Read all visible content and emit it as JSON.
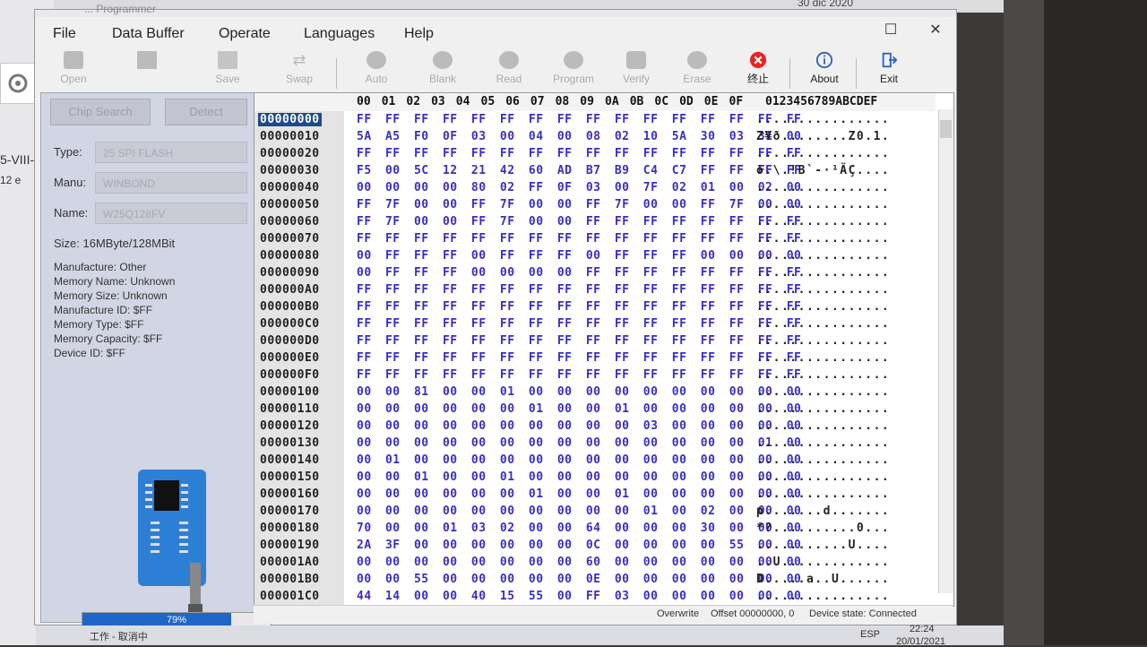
{
  "window": {
    "title": "... Programmer",
    "date_top": "30 dic 2020"
  },
  "background": {
    "side_text_1": "5-VIII-",
    "side_text_2": "12 e"
  },
  "menu": [
    "File",
    "Data Buffer",
    "Operate",
    "Languages",
    "Help"
  ],
  "toolbar": [
    {
      "label": "Open",
      "active": false
    },
    {
      "label": "",
      "active": false
    },
    {
      "label": "Save",
      "active": false
    },
    {
      "label": "Swap",
      "active": false
    },
    {
      "label": "Auto",
      "active": false
    },
    {
      "label": "Blank",
      "active": false
    },
    {
      "label": "Read",
      "active": false
    },
    {
      "label": "Program",
      "active": false
    },
    {
      "label": "Verify",
      "active": false
    },
    {
      "label": "Erase",
      "active": false
    },
    {
      "label": "终止",
      "active": true
    },
    {
      "label": "About",
      "active": true
    },
    {
      "label": "Exit",
      "active": true
    }
  ],
  "left": {
    "chip_search": "Chip Search",
    "detect": "Detect",
    "type_label": "Type:",
    "type_value": "25 SPI FLASH",
    "manu_label": "Manu:",
    "manu_value": "WINBOND",
    "name_label": "Name:",
    "name_value": "W25Q128FV",
    "size": "Size:  16MByte/128MBit",
    "info": [
      "Manufacture: Other",
      "Memory Name: Unknown",
      "Memory Size: Unknown",
      "Manufacture ID: $FF",
      "Memory Type: $FF",
      "Memory Capacity: $FF",
      "Device ID: $FF"
    ],
    "progress_value": 0.79,
    "progress_text": "79%"
  },
  "hex": {
    "header_cols": [
      "00",
      "01",
      "02",
      "03",
      "04",
      "05",
      "06",
      "07",
      "08",
      "09",
      "0A",
      "0B",
      "0C",
      "0D",
      "0E",
      "0F"
    ],
    "ascii_header": "0123456789ABCDEF",
    "rows": [
      {
        "addr": "00000000",
        "bytes": "FF FF FF FF FF FF FF FF FF FF FF FF FF FF FF FF",
        "ascii": "................"
      },
      {
        "addr": "00000010",
        "bytes": "5A A5 F0 0F 03 00 04 00 08 02 10 5A 30 03 31 00",
        "ascii": "Z¥ð........Z0.1."
      },
      {
        "addr": "00000020",
        "bytes": "FF FF FF FF FF FF FF FF FF FF FF FF FF FF FF FF",
        "ascii": "................"
      },
      {
        "addr": "00000030",
        "bytes": "F5 00 5C 12 21 42 60 AD B7 B9 C4 C7 FF FF FF FF",
        "ascii": "õ.\\.!B`-·¹ÄÇ...."
      },
      {
        "addr": "00000040",
        "bytes": "00 00 00 00 80 02 FF 0F 03 00 7F 02 01 00 02 00",
        "ascii": "................"
      },
      {
        "addr": "00000050",
        "bytes": "FF 7F 00 00 FF 7F 00 00 FF 7F 00 00 FF 7F 00 00",
        "ascii": "................"
      },
      {
        "addr": "00000060",
        "bytes": "FF 7F 00 00 FF 7F 00 00 FF FF FF FF FF FF FF FF",
        "ascii": "................"
      },
      {
        "addr": "00000070",
        "bytes": "FF FF FF FF FF FF FF FF FF FF FF FF FF FF FF FF",
        "ascii": "................"
      },
      {
        "addr": "00000080",
        "bytes": "00 FF FF FF 00 FF FF FF 00 FF FF FF 00 00 00 00",
        "ascii": "................"
      },
      {
        "addr": "00000090",
        "bytes": "00 FF FF FF 00 00 00 00 FF FF FF FF FF FF FF FF",
        "ascii": "................"
      },
      {
        "addr": "000000A0",
        "bytes": "FF FF FF FF FF FF FF FF FF FF FF FF FF FF FF FF",
        "ascii": "................"
      },
      {
        "addr": "000000B0",
        "bytes": "FF FF FF FF FF FF FF FF FF FF FF FF FF FF FF FF",
        "ascii": "................"
      },
      {
        "addr": "000000C0",
        "bytes": "FF FF FF FF FF FF FF FF FF FF FF FF FF FF FF FF",
        "ascii": "................"
      },
      {
        "addr": "000000D0",
        "bytes": "FF FF FF FF FF FF FF FF FF FF FF FF FF FF FF FF",
        "ascii": "................"
      },
      {
        "addr": "000000E0",
        "bytes": "FF FF FF FF FF FF FF FF FF FF FF FF FF FF FF FF",
        "ascii": "................"
      },
      {
        "addr": "000000F0",
        "bytes": "FF FF FF FF FF FF FF FF FF FF FF FF FF FF FF FF",
        "ascii": "................"
      },
      {
        "addr": "00000100",
        "bytes": "00 00 81 00 00 01 00 00 00 00 00 00 00 00 00 00",
        "ascii": "................"
      },
      {
        "addr": "00000110",
        "bytes": "00 00 00 00 00 00 01 00 00 01 00 00 00 00 00 00",
        "ascii": "................"
      },
      {
        "addr": "00000120",
        "bytes": "00 00 00 00 00 00 00 00 00 00 03 00 00 00 00 00",
        "ascii": "................"
      },
      {
        "addr": "00000130",
        "bytes": "00 00 00 00 00 00 00 00 00 00 00 00 00 00 01 00",
        "ascii": "................"
      },
      {
        "addr": "00000140",
        "bytes": "00 01 00 00 00 00 00 00 00 00 00 00 00 00 00 00",
        "ascii": "................"
      },
      {
        "addr": "00000150",
        "bytes": "00 00 01 00 00 01 00 00 00 00 00 00 00 00 00 00",
        "ascii": "................"
      },
      {
        "addr": "00000160",
        "bytes": "00 00 00 00 00 00 01 00 00 01 00 00 00 00 00 00",
        "ascii": "................"
      },
      {
        "addr": "00000170",
        "bytes": "00 00 00 00 00 00 00 00 00 00 01 00 02 00 00 00",
        "ascii": "p.......d......."
      },
      {
        "addr": "00000180",
        "bytes": "70 00 00 01 03 02 00 00 64 00 00 00 30 00 00 00",
        "ascii": "*?..........0..."
      },
      {
        "addr": "00000190",
        "bytes": "2A 3F 00 00 00 00 00 00 0C 00 00 00 00 55 00 00",
        "ascii": "...........U...."
      },
      {
        "addr": "000001A0",
        "bytes": "00 00 00 00 00 00 00 00 60 00 00 00 00 00 00 00",
        "ascii": "..U............."
      },
      {
        "addr": "000001B0",
        "bytes": "00 00 55 00 00 00 00 00 0E 00 00 00 00 00 00 00",
        "ascii": "D.....a..U......"
      },
      {
        "addr": "000001C0",
        "bytes": "44 14 00 00 40 15 55 00 FF 03 00 00 00 00 00 00",
        "ascii": "................"
      }
    ]
  },
  "status": {
    "mode": "Overwrite",
    "offset": "Offset 00000000, 0",
    "device": "Device state: Connected"
  },
  "taskbar": {
    "left": "工作 - 取消中",
    "lang": "ESP",
    "time": "22:24",
    "date": "20/01/2021"
  }
}
